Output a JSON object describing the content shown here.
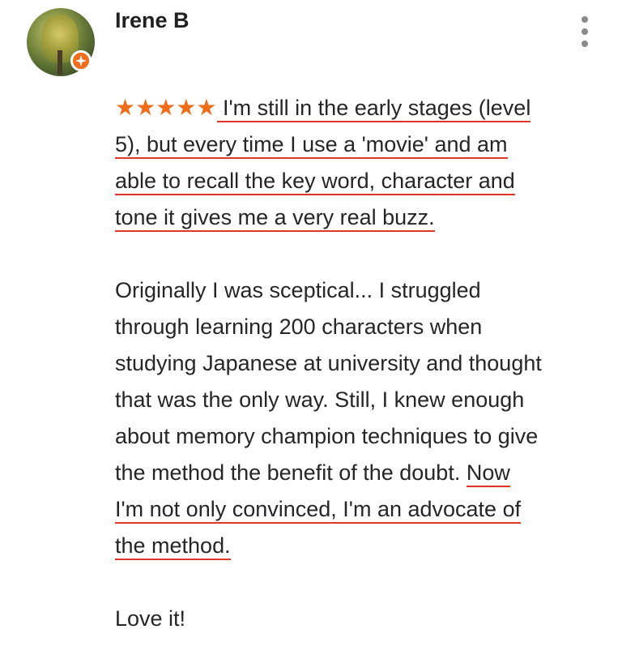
{
  "reviewer": {
    "name": "Irene B",
    "avatar_icon": "profile-photo",
    "badge_icon": "local-guide-badge",
    "badge_color": "#ef6c1a"
  },
  "menu_icon": "more-vert-icon",
  "rating": {
    "stars": 5,
    "max": 5,
    "glyphs": "★★★★★",
    "color": "#ef6c1a"
  },
  "highlight_color": "#e0352b",
  "review": {
    "p1": [
      " I'm still in the early stages (level",
      "5), but every time I use a 'movie' and am",
      "able to recall the key word, character and",
      "tone it gives me a very real buzz."
    ],
    "p2": [
      "Originally I was sceptical... I struggled",
      "through learning 200 characters when",
      "studying Japanese at university and thought",
      "that was the only way. Still, I knew enough",
      "about memory champion techniques to give",
      "the method the benefit of the doubt. ",
      "Now",
      "I'm not only convinced, I'm an advocate of",
      "the method."
    ],
    "p3": "Love it!"
  }
}
